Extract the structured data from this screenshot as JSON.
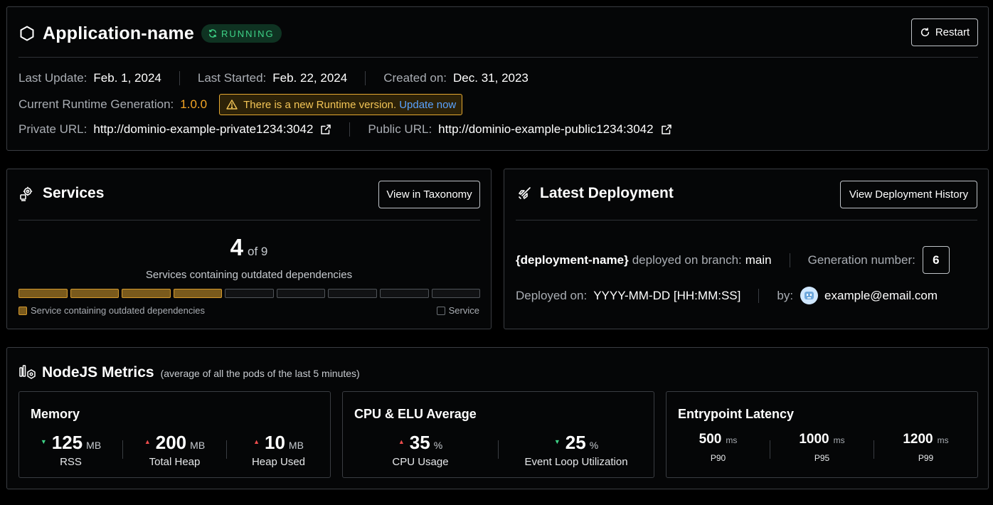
{
  "app": {
    "name": "Application-name",
    "status": "RUNNING",
    "restart_label": "Restart",
    "last_update_label": "Last Update:",
    "last_update": "Feb. 1, 2024",
    "last_started_label": "Last Started:",
    "last_started": "Feb. 22, 2024",
    "created_label": "Created on:",
    "created": "Dec. 31, 2023",
    "runtime_label": "Current Runtime Generation:",
    "runtime_version": "1.0.0",
    "runtime_warning": "There is a new Runtime version.",
    "runtime_update_link": "Update now",
    "private_url_label": "Private URL:",
    "private_url": "http://dominio-example-private1234:3042",
    "public_url_label": "Public URL:",
    "public_url": "http://dominio-example-public1234:3042"
  },
  "services": {
    "title": "Services",
    "taxonomy_button": "View in Taxonomy",
    "outdated_count": "4",
    "of_total": "of 9",
    "caption": "Services containing outdated dependencies",
    "total": 9,
    "outdated": 4,
    "legend_outdated": "Service containing outdated dependencies",
    "legend_service": "Service"
  },
  "deployment": {
    "title": "Latest Deployment",
    "history_button": "View Deployment History",
    "name": "{deployment-name}",
    "branch_text": "deployed on branch:",
    "branch": "main",
    "generation_label": "Generation number:",
    "generation": "6",
    "deployed_on_label": "Deployed on:",
    "deployed_on": "YYYY-MM-DD [HH:MM:SS]",
    "by_label": "by:",
    "email": "example@email.com"
  },
  "metrics": {
    "title": "NodeJS Metrics",
    "subtitle": "(average of all the pods of the last 5 minutes)",
    "memory": {
      "title": "Memory",
      "stats": [
        {
          "value": "125",
          "unit": "MB",
          "label": "RSS",
          "trend": "down"
        },
        {
          "value": "200",
          "unit": "MB",
          "label": "Total Heap",
          "trend": "up"
        },
        {
          "value": "10",
          "unit": "MB",
          "label": "Heap Used",
          "trend": "up"
        }
      ]
    },
    "cpu": {
      "title": "CPU & ELU Average",
      "stats": [
        {
          "value": "35",
          "unit": "%",
          "label": "CPU Usage",
          "trend": "up"
        },
        {
          "value": "25",
          "unit": "%",
          "label": "Event Loop Utilization",
          "trend": "down"
        }
      ]
    },
    "latency": {
      "title": "Entrypoint Latency",
      "stats": [
        {
          "value": "500",
          "unit": "ms",
          "label": "P90"
        },
        {
          "value": "1000",
          "unit": "ms",
          "label": "P95"
        },
        {
          "value": "1200",
          "unit": "ms",
          "label": "P99"
        }
      ]
    }
  },
  "colors": {
    "running": "#3ed387",
    "warning": "#f5a524",
    "link": "#5aa3ff",
    "trend_up": "#f04d4d",
    "trend_down": "#3ed387"
  }
}
